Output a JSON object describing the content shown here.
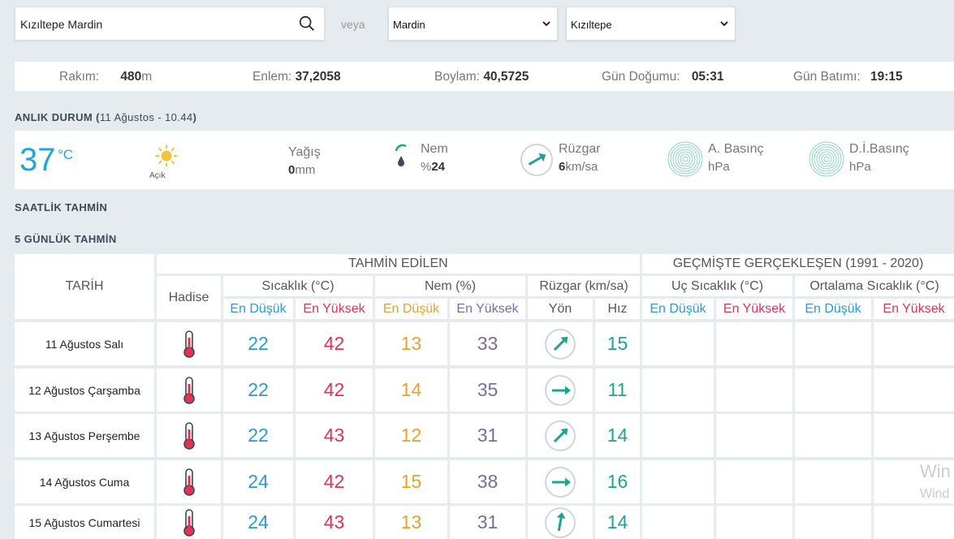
{
  "search": {
    "value": "Kızıltepe Mardin",
    "icon": "search-icon"
  },
  "veya": "veya",
  "province_select": {
    "selected": "Mardin"
  },
  "district_select": {
    "selected": "Kızıltepe"
  },
  "info": {
    "altitude_label": "Rakım:",
    "altitude_value": "480",
    "altitude_unit": "m",
    "lat_label": "Enlem:",
    "lat_value": "37,2058",
    "lon_label": "Boylam:",
    "lon_value": "40,5725",
    "sunrise_label": "Gün Doğumu:",
    "sunrise_value": "05:31",
    "sunset_label": "Gün Batımı:",
    "sunset_value": "19:15"
  },
  "current": {
    "title": "ANLIK DURUM",
    "title_open": "(",
    "timestamp": "11 Ağustos - 10.44",
    "title_close": ")",
    "temp": "37",
    "temp_unit": "°C",
    "condition": "Açık",
    "rain_label": "Yağış",
    "rain_value": "0",
    "rain_unit": "mm",
    "humidity_label": "Nem",
    "humidity_prefix": "%",
    "humidity_value": "24",
    "wind_label": "Rüzgar",
    "wind_value": "6",
    "wind_unit": "km/sa",
    "pressure_label": "A. Basınç",
    "pressure_unit": "hPa",
    "sea_pressure_label": "D.İ.Basınç",
    "sea_pressure_unit": "hPa"
  },
  "hourly_title": "SAATLİK TAHMİN",
  "daily_title": "5 GÜNLÜK TAHMİN",
  "table": {
    "date_header": "TARİH",
    "forecast_header": "TAHMİN EDİLEN",
    "history_header": "GEÇMİŞTE GERÇEKLEŞEN (1991 - 2020)",
    "event_header": "Hadise",
    "temp_header": "Sıcaklık (°C)",
    "hum_header": "Nem (%)",
    "wind_header": "Rüzgar (km/sa)",
    "extreme_header": "Uç Sıcaklık (°C)",
    "avg_header": "Ortalama Sıcaklık (°C)",
    "min_label": "En Düşük",
    "max_label": "En Yüksek",
    "dir_label": "Yön",
    "speed_label": "Hız",
    "rows": [
      {
        "date": "11 Ağustos Salı",
        "tmin": "22",
        "tmax": "42",
        "hmin": "13",
        "hmax": "33",
        "wind_dir_deg": 45,
        "wind_speed": "15"
      },
      {
        "date": "12 Ağustos Çarşamba",
        "tmin": "22",
        "tmax": "42",
        "hmin": "14",
        "hmax": "35",
        "wind_dir_deg": 90,
        "wind_speed": "11"
      },
      {
        "date": "13 Ağustos Perşembe",
        "tmin": "22",
        "tmax": "43",
        "hmin": "12",
        "hmax": "31",
        "wind_dir_deg": 45,
        "wind_speed": "14"
      },
      {
        "date": "14 Ağustos Cuma",
        "tmin": "24",
        "tmax": "42",
        "hmin": "15",
        "hmax": "38",
        "wind_dir_deg": 90,
        "wind_speed": "16"
      },
      {
        "date": "15 Ağustos Cumartesi",
        "tmin": "24",
        "tmax": "43",
        "hmin": "13",
        "hmax": "31",
        "wind_dir_deg": 10,
        "wind_speed": "14"
      }
    ]
  },
  "watermark": {
    "line1": "Win",
    "line2": "Wind"
  },
  "colors": {
    "accent_blue": "#23a7d4",
    "min_blue": "#2a9ad2",
    "max_red": "#e03355",
    "hum_orange": "#e8a12d",
    "hum_purple": "#7a6ca3",
    "wind_teal": "#1fa58f"
  }
}
